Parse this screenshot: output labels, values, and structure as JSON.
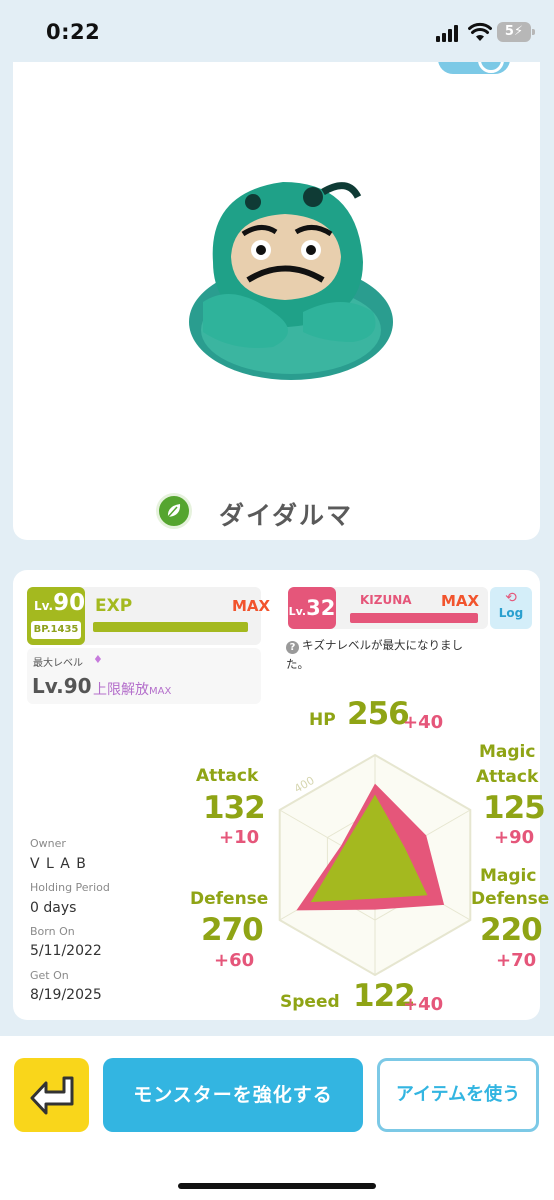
{
  "status_bar": {
    "time": "0:22",
    "battery": "5"
  },
  "monster": {
    "name": "ダイダルマ",
    "type_icon": "leaf-icon"
  },
  "level": {
    "lv_prefix": "Lv.",
    "lv_value": "90",
    "bp": "BP.1435",
    "exp_label": "EXP",
    "exp_max": "MAX",
    "exp_progress": 1.0
  },
  "max_level": {
    "label": "最大レベル",
    "icon": "gem-icon",
    "value": "Lv.90",
    "limit_text": "上限解放",
    "limit_suffix": "MAX"
  },
  "kizuna": {
    "lv_prefix": "Lv.",
    "lv_value": "32",
    "label": "KIZUNA",
    "max": "MAX",
    "progress": 1.0,
    "log_label": "Log",
    "note_line1": "キズナレベルが最大になりまし",
    "note_line2": "た。"
  },
  "meta": {
    "owner_label": "Owner",
    "owner_value": "V L A B",
    "holding_label": "Holding Period",
    "holding_value": "0 days",
    "born_label": "Born On",
    "born_value": "5/11/2022",
    "get_label": "Get On",
    "get_value": "8/19/2025"
  },
  "stats": {
    "hp": {
      "label": "HP",
      "value": "256",
      "bonus": "+40"
    },
    "attack": {
      "label": "Attack",
      "value": "132",
      "bonus": "+10"
    },
    "magic_attack": {
      "label1": "Magic",
      "label2": "Attack",
      "value": "125",
      "bonus": "+90"
    },
    "defense": {
      "label": "Defense",
      "value": "270",
      "bonus": "+60"
    },
    "magic_defense": {
      "label1": "Magic",
      "label2": "Defense",
      "value": "220",
      "bonus": "+70"
    },
    "speed": {
      "label": "Speed",
      "value": "122",
      "bonus": "+40"
    }
  },
  "radar": {
    "scale_label": "400",
    "max": 400,
    "base": {
      "hp": 256,
      "magic_attack": 125,
      "magic_defense": 220,
      "speed": 122,
      "defense": 270,
      "attack": 132
    },
    "total": {
      "hp": 296,
      "magic_attack": 215,
      "magic_defense": 290,
      "speed": 162,
      "defense": 330,
      "attack": 142
    },
    "colors": {
      "base": "#a4b91f",
      "bonus": "#e5567a",
      "grid": "#e6e6d0"
    }
  },
  "buttons": {
    "enhance": "モンスターを強化する",
    "use_item": "アイテムを使う"
  },
  "colors": {
    "accent_blue": "#33b5e1",
    "accent_green": "#a4b91f",
    "accent_pink": "#e5567a",
    "yellow": "#f9d61b"
  }
}
